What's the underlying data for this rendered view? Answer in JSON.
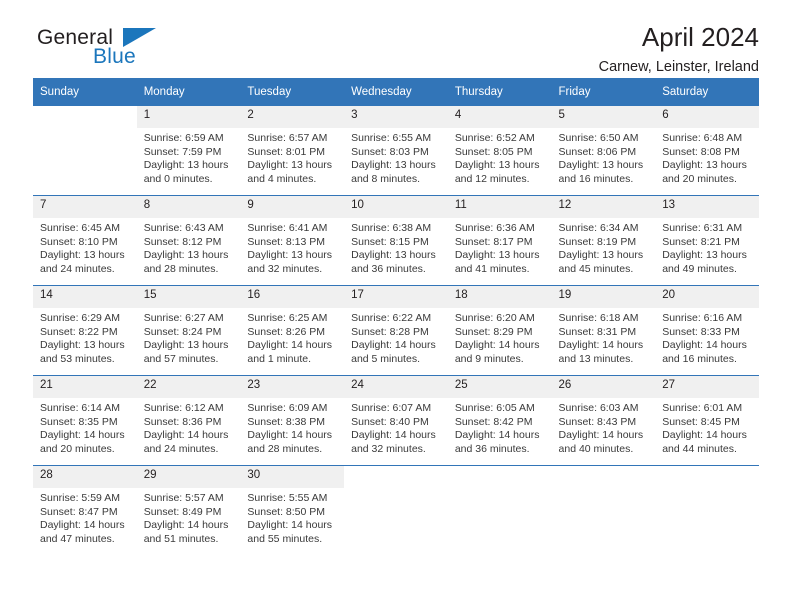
{
  "brand": {
    "name_part1": "General",
    "name_part2": "Blue",
    "accent_color": "#1b76bc",
    "logo_icon": "triangle-icon"
  },
  "header": {
    "title": "April 2024",
    "subtitle": "Carnew, Leinster, Ireland"
  },
  "calendar": {
    "header_color": "#3275b8",
    "daynum_background": "#f0f0f0",
    "weekday_headers": [
      "Sunday",
      "Monday",
      "Tuesday",
      "Wednesday",
      "Thursday",
      "Friday",
      "Saturday"
    ],
    "weeks": [
      [
        {
          "day": "",
          "sunrise": "",
          "sunset": "",
          "daylight_line1": "",
          "daylight_line2": "",
          "empty": true
        },
        {
          "day": "1",
          "sunrise": "Sunrise: 6:59 AM",
          "sunset": "Sunset: 7:59 PM",
          "daylight_line1": "Daylight: 13 hours",
          "daylight_line2": "and 0 minutes."
        },
        {
          "day": "2",
          "sunrise": "Sunrise: 6:57 AM",
          "sunset": "Sunset: 8:01 PM",
          "daylight_line1": "Daylight: 13 hours",
          "daylight_line2": "and 4 minutes."
        },
        {
          "day": "3",
          "sunrise": "Sunrise: 6:55 AM",
          "sunset": "Sunset: 8:03 PM",
          "daylight_line1": "Daylight: 13 hours",
          "daylight_line2": "and 8 minutes."
        },
        {
          "day": "4",
          "sunrise": "Sunrise: 6:52 AM",
          "sunset": "Sunset: 8:05 PM",
          "daylight_line1": "Daylight: 13 hours",
          "daylight_line2": "and 12 minutes."
        },
        {
          "day": "5",
          "sunrise": "Sunrise: 6:50 AM",
          "sunset": "Sunset: 8:06 PM",
          "daylight_line1": "Daylight: 13 hours",
          "daylight_line2": "and 16 minutes."
        },
        {
          "day": "6",
          "sunrise": "Sunrise: 6:48 AM",
          "sunset": "Sunset: 8:08 PM",
          "daylight_line1": "Daylight: 13 hours",
          "daylight_line2": "and 20 minutes."
        }
      ],
      [
        {
          "day": "7",
          "sunrise": "Sunrise: 6:45 AM",
          "sunset": "Sunset: 8:10 PM",
          "daylight_line1": "Daylight: 13 hours",
          "daylight_line2": "and 24 minutes."
        },
        {
          "day": "8",
          "sunrise": "Sunrise: 6:43 AM",
          "sunset": "Sunset: 8:12 PM",
          "daylight_line1": "Daylight: 13 hours",
          "daylight_line2": "and 28 minutes."
        },
        {
          "day": "9",
          "sunrise": "Sunrise: 6:41 AM",
          "sunset": "Sunset: 8:13 PM",
          "daylight_line1": "Daylight: 13 hours",
          "daylight_line2": "and 32 minutes."
        },
        {
          "day": "10",
          "sunrise": "Sunrise: 6:38 AM",
          "sunset": "Sunset: 8:15 PM",
          "daylight_line1": "Daylight: 13 hours",
          "daylight_line2": "and 36 minutes."
        },
        {
          "day": "11",
          "sunrise": "Sunrise: 6:36 AM",
          "sunset": "Sunset: 8:17 PM",
          "daylight_line1": "Daylight: 13 hours",
          "daylight_line2": "and 41 minutes."
        },
        {
          "day": "12",
          "sunrise": "Sunrise: 6:34 AM",
          "sunset": "Sunset: 8:19 PM",
          "daylight_line1": "Daylight: 13 hours",
          "daylight_line2": "and 45 minutes."
        },
        {
          "day": "13",
          "sunrise": "Sunrise: 6:31 AM",
          "sunset": "Sunset: 8:21 PM",
          "daylight_line1": "Daylight: 13 hours",
          "daylight_line2": "and 49 minutes."
        }
      ],
      [
        {
          "day": "14",
          "sunrise": "Sunrise: 6:29 AM",
          "sunset": "Sunset: 8:22 PM",
          "daylight_line1": "Daylight: 13 hours",
          "daylight_line2": "and 53 minutes."
        },
        {
          "day": "15",
          "sunrise": "Sunrise: 6:27 AM",
          "sunset": "Sunset: 8:24 PM",
          "daylight_line1": "Daylight: 13 hours",
          "daylight_line2": "and 57 minutes."
        },
        {
          "day": "16",
          "sunrise": "Sunrise: 6:25 AM",
          "sunset": "Sunset: 8:26 PM",
          "daylight_line1": "Daylight: 14 hours",
          "daylight_line2": "and 1 minute."
        },
        {
          "day": "17",
          "sunrise": "Sunrise: 6:22 AM",
          "sunset": "Sunset: 8:28 PM",
          "daylight_line1": "Daylight: 14 hours",
          "daylight_line2": "and 5 minutes."
        },
        {
          "day": "18",
          "sunrise": "Sunrise: 6:20 AM",
          "sunset": "Sunset: 8:29 PM",
          "daylight_line1": "Daylight: 14 hours",
          "daylight_line2": "and 9 minutes."
        },
        {
          "day": "19",
          "sunrise": "Sunrise: 6:18 AM",
          "sunset": "Sunset: 8:31 PM",
          "daylight_line1": "Daylight: 14 hours",
          "daylight_line2": "and 13 minutes."
        },
        {
          "day": "20",
          "sunrise": "Sunrise: 6:16 AM",
          "sunset": "Sunset: 8:33 PM",
          "daylight_line1": "Daylight: 14 hours",
          "daylight_line2": "and 16 minutes."
        }
      ],
      [
        {
          "day": "21",
          "sunrise": "Sunrise: 6:14 AM",
          "sunset": "Sunset: 8:35 PM",
          "daylight_line1": "Daylight: 14 hours",
          "daylight_line2": "and 20 minutes."
        },
        {
          "day": "22",
          "sunrise": "Sunrise: 6:12 AM",
          "sunset": "Sunset: 8:36 PM",
          "daylight_line1": "Daylight: 14 hours",
          "daylight_line2": "and 24 minutes."
        },
        {
          "day": "23",
          "sunrise": "Sunrise: 6:09 AM",
          "sunset": "Sunset: 8:38 PM",
          "daylight_line1": "Daylight: 14 hours",
          "daylight_line2": "and 28 minutes."
        },
        {
          "day": "24",
          "sunrise": "Sunrise: 6:07 AM",
          "sunset": "Sunset: 8:40 PM",
          "daylight_line1": "Daylight: 14 hours",
          "daylight_line2": "and 32 minutes."
        },
        {
          "day": "25",
          "sunrise": "Sunrise: 6:05 AM",
          "sunset": "Sunset: 8:42 PM",
          "daylight_line1": "Daylight: 14 hours",
          "daylight_line2": "and 36 minutes."
        },
        {
          "day": "26",
          "sunrise": "Sunrise: 6:03 AM",
          "sunset": "Sunset: 8:43 PM",
          "daylight_line1": "Daylight: 14 hours",
          "daylight_line2": "and 40 minutes."
        },
        {
          "day": "27",
          "sunrise": "Sunrise: 6:01 AM",
          "sunset": "Sunset: 8:45 PM",
          "daylight_line1": "Daylight: 14 hours",
          "daylight_line2": "and 44 minutes."
        }
      ],
      [
        {
          "day": "28",
          "sunrise": "Sunrise: 5:59 AM",
          "sunset": "Sunset: 8:47 PM",
          "daylight_line1": "Daylight: 14 hours",
          "daylight_line2": "and 47 minutes."
        },
        {
          "day": "29",
          "sunrise": "Sunrise: 5:57 AM",
          "sunset": "Sunset: 8:49 PM",
          "daylight_line1": "Daylight: 14 hours",
          "daylight_line2": "and 51 minutes."
        },
        {
          "day": "30",
          "sunrise": "Sunrise: 5:55 AM",
          "sunset": "Sunset: 8:50 PM",
          "daylight_line1": "Daylight: 14 hours",
          "daylight_line2": "and 55 minutes."
        },
        {
          "day": "",
          "sunrise": "",
          "sunset": "",
          "daylight_line1": "",
          "daylight_line2": "",
          "empty": true
        },
        {
          "day": "",
          "sunrise": "",
          "sunset": "",
          "daylight_line1": "",
          "daylight_line2": "",
          "empty": true
        },
        {
          "day": "",
          "sunrise": "",
          "sunset": "",
          "daylight_line1": "",
          "daylight_line2": "",
          "empty": true
        },
        {
          "day": "",
          "sunrise": "",
          "sunset": "",
          "daylight_line1": "",
          "daylight_line2": "",
          "empty": true
        }
      ]
    ]
  }
}
